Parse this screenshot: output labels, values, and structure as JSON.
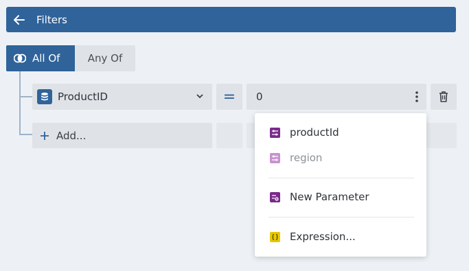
{
  "header": {
    "title": "Filters",
    "back_icon": "arrow-left-icon"
  },
  "group": {
    "all_of_label": "All Of",
    "any_of_label": "Any Of",
    "selected": "All Of"
  },
  "condition": {
    "field_label": "ProductID",
    "field_icon": "database-icon",
    "operator": "=",
    "value": "0"
  },
  "add_label": "Add...",
  "menu": {
    "items": [
      {
        "label": "productId",
        "icon": "parameter-icon",
        "disabled": false
      },
      {
        "label": "region",
        "icon": "parameter-icon",
        "disabled": true
      },
      {
        "label": "New Parameter",
        "icon": "new-parameter-icon",
        "disabled": false
      },
      {
        "label": "Expression...",
        "icon": "expression-icon",
        "disabled": false
      }
    ]
  },
  "colors": {
    "primary": "#2f6399",
    "param_purple": "#7a2a8a",
    "param_disabled": "#c793cf",
    "expression_yellow": "#e6c700"
  }
}
